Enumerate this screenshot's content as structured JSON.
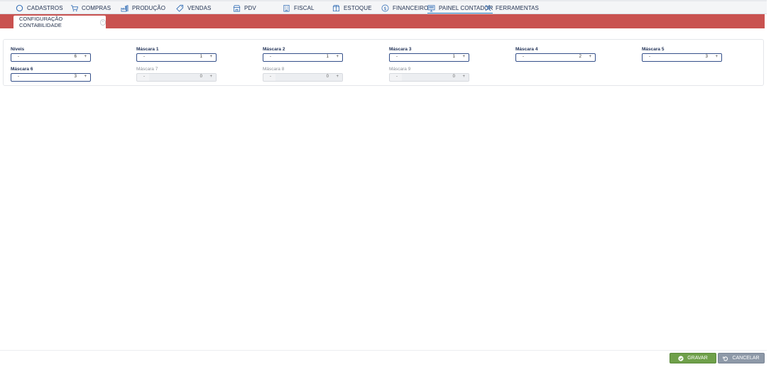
{
  "nav": [
    {
      "label": "CADASTROS",
      "icon": "circle-icon"
    },
    {
      "label": "COMPRAS",
      "icon": "cart-icon"
    },
    {
      "label": "PRODUÇÃO",
      "icon": "factory-icon"
    },
    {
      "label": "VENDAS",
      "icon": "tag-icon"
    },
    {
      "label": "PDV",
      "icon": "store-icon"
    },
    {
      "label": "FISCAL",
      "icon": "building-icon"
    },
    {
      "label": "ESTOQUE",
      "icon": "box-icon"
    },
    {
      "label": "FINANCEIRO",
      "icon": "dollar-icon"
    },
    {
      "label": "PAINEL CONTADOR",
      "icon": "monitor-icon",
      "active": true
    },
    {
      "label": "FERRAMENTAS",
      "icon": "tools-icon"
    }
  ],
  "tab": {
    "label": "CONFIGURAÇÃO CONTABILIDADE"
  },
  "fields": [
    {
      "label": "Níveis",
      "value": "6",
      "enabled": true
    },
    {
      "label": "Máscara 1",
      "value": "1",
      "enabled": true
    },
    {
      "label": "Máscara 2",
      "value": "1",
      "enabled": true
    },
    {
      "label": "Máscara 3",
      "value": "1",
      "enabled": true
    },
    {
      "label": "Máscara 4",
      "value": "2",
      "enabled": true
    },
    {
      "label": "Máscara 5",
      "value": "3",
      "enabled": true
    },
    {
      "label": "Máscara 6",
      "value": "3",
      "enabled": true
    },
    {
      "label": "Máscara 7",
      "value": "0",
      "enabled": false
    },
    {
      "label": "Máscara 8",
      "value": "0",
      "enabled": false
    },
    {
      "label": "Máscara 9",
      "value": "0",
      "enabled": false
    }
  ],
  "spinner": {
    "minus": "-",
    "plus": "+"
  },
  "buttons": {
    "save": "GRAVAR",
    "cancel": "CANCELAR"
  },
  "colors": {
    "accent_red": "#c95250",
    "save_green": "#6fa04a",
    "cancel_gray": "#8e99a8",
    "nav_text": "#233352"
  }
}
